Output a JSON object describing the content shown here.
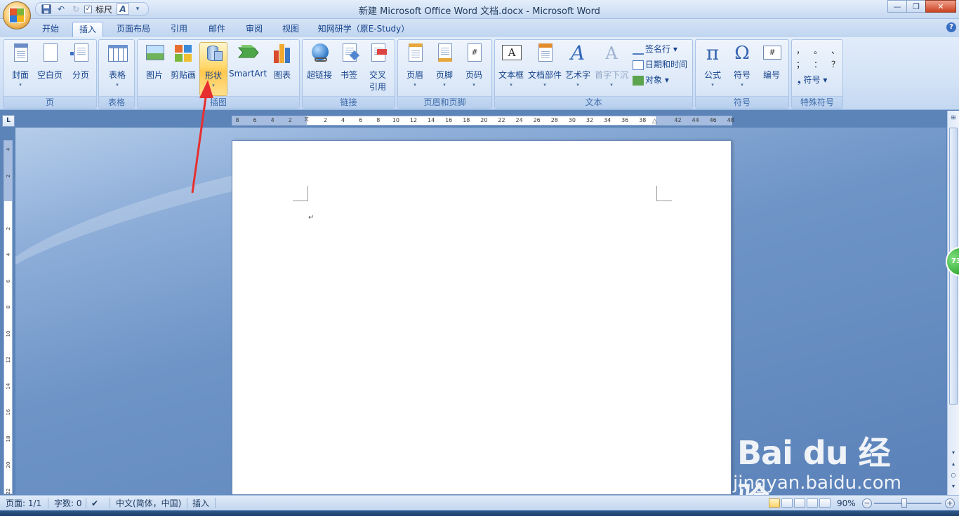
{
  "window": {
    "title": "新建 Microsoft Office Word 文档.docx - Microsoft Word",
    "qat_ruler_label": "标尺",
    "qat_ruler_checked": "✓"
  },
  "tabs": [
    "开始",
    "插入",
    "页面布局",
    "引用",
    "邮件",
    "审阅",
    "视图",
    "知网研学（原E-Study）"
  ],
  "active_tab": "插入",
  "ribbon": {
    "groups": {
      "pages": {
        "label": "页",
        "buttons": [
          "封面",
          "空白页",
          "分页"
        ]
      },
      "tables": {
        "label": "表格",
        "buttons": [
          "表格"
        ]
      },
      "illustrations": {
        "label": "插图",
        "buttons": [
          "图片",
          "剪贴画",
          "形状",
          "SmartArt",
          "图表"
        ]
      },
      "links": {
        "label": "链接",
        "buttons": [
          "超链接",
          "书签",
          "交叉引用_1",
          "交叉引用_2"
        ],
        "cross_ref_line1": "交叉",
        "cross_ref_line2": "引用"
      },
      "header_footer": {
        "label": "页眉和页脚",
        "buttons": [
          "页眉",
          "页脚",
          "页码"
        ]
      },
      "text": {
        "label": "文本",
        "buttons": [
          "文本框",
          "文档部件",
          "艺术字",
          "首字下沉"
        ],
        "small": [
          "签名行",
          "日期和时间",
          "对象"
        ]
      },
      "symbols": {
        "label": "符号",
        "buttons": [
          "公式",
          "符号",
          "编号"
        ]
      },
      "special": {
        "label": "特殊符号",
        "chars_row1": [
          "，",
          "。",
          "、"
        ],
        "chars_row2": [
          "；",
          "：",
          "？"
        ],
        "symbol_btn": "符号"
      }
    }
  },
  "ruler_corner": "L",
  "hruler_numbers": [
    "8",
    "6",
    "4",
    "2",
    "",
    "2",
    "4",
    "6",
    "8",
    "10",
    "12",
    "14",
    "16",
    "18",
    "20",
    "22",
    "24",
    "26",
    "28",
    "30",
    "32",
    "34",
    "36",
    "38",
    "",
    "42",
    "44",
    "46",
    "48"
  ],
  "vruler_numbers": [
    "4",
    "2",
    "",
    "2",
    "4",
    "6",
    "8",
    "10",
    "12",
    "14",
    "16",
    "18",
    "20",
    "22"
  ],
  "document": {
    "paragraph_mark": "↵"
  },
  "word_count_bubble": "73",
  "status": {
    "page": "页面: 1/1",
    "words": "字数: 0",
    "language": "中文(简体，中国)",
    "mode": "插入",
    "zoom": "90%"
  },
  "watermark": {
    "logo": "Bai du 经验",
    "site": "jingyan.baidu.com"
  },
  "colors": {
    "accent": "#15428b",
    "highlight": "#ffd36c",
    "arrow": "#e63030"
  }
}
